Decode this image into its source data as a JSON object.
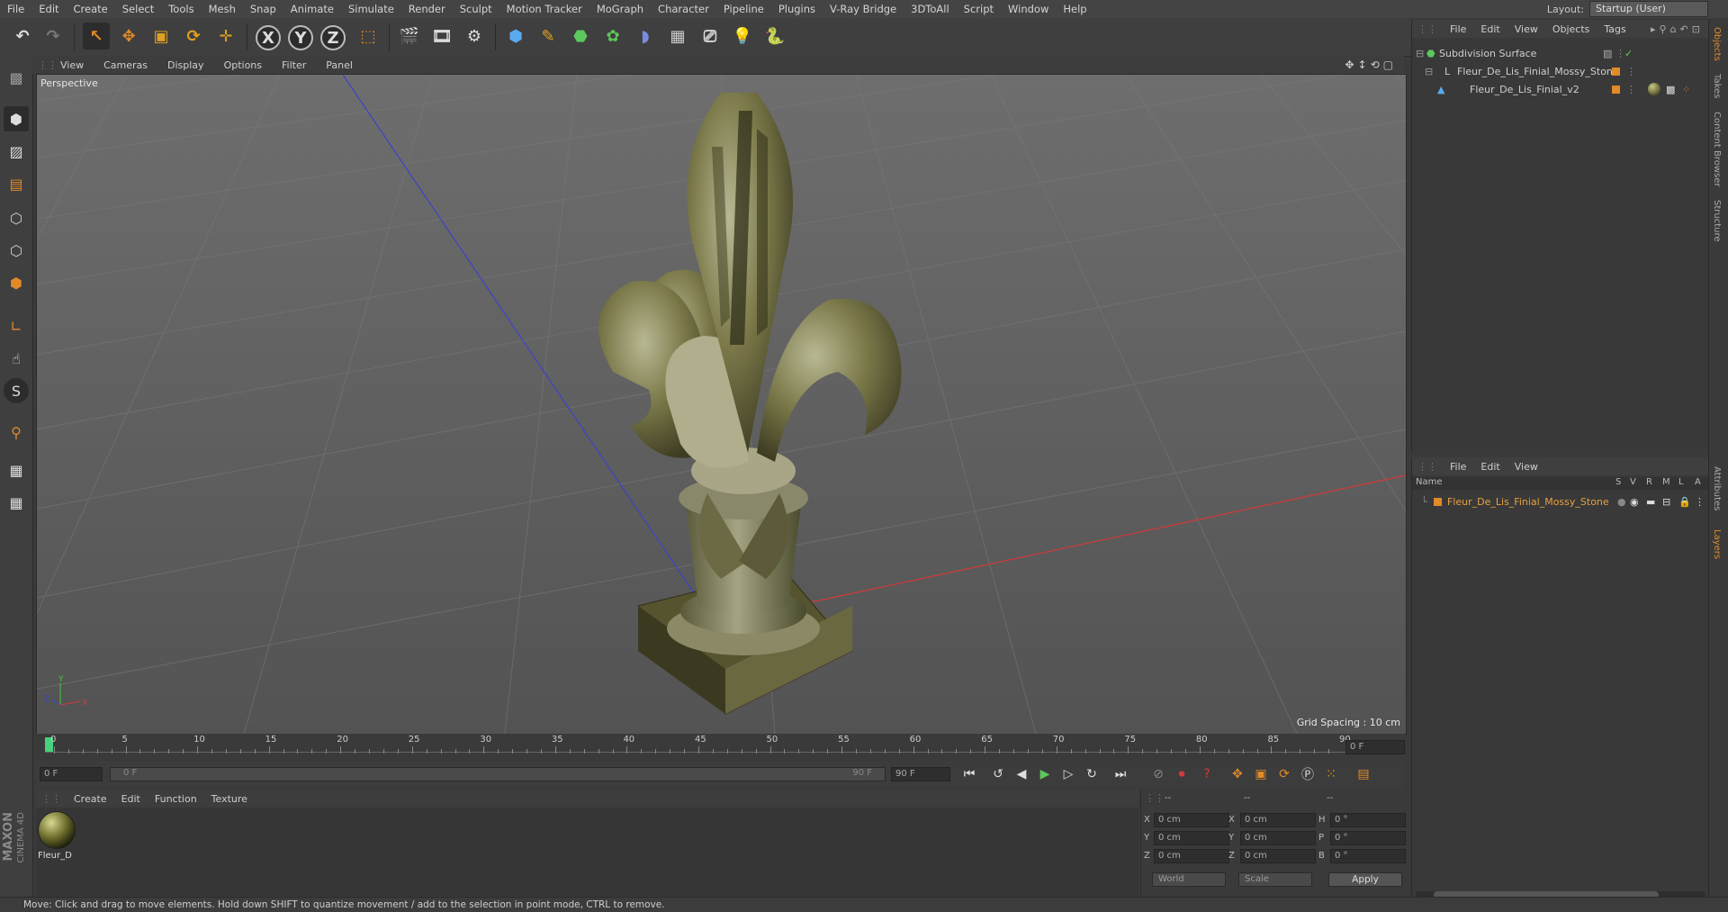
{
  "menubar": {
    "items": [
      "File",
      "Edit",
      "Create",
      "Select",
      "Tools",
      "Mesh",
      "Snap",
      "Animate",
      "Simulate",
      "Render",
      "Sculpt",
      "Motion Tracker",
      "MoGraph",
      "Character",
      "Pipeline",
      "Plugins",
      "V-Ray Bridge",
      "3DToAll",
      "Script",
      "Window",
      "Help"
    ],
    "layout_label": "Layout:",
    "layout_value": "Startup (User)"
  },
  "viewport": {
    "menu": [
      "View",
      "Cameras",
      "Display",
      "Options",
      "Filter",
      "Panel"
    ],
    "label": "Perspective",
    "grid_spacing": "Grid Spacing : 10 cm"
  },
  "timeline": {
    "ticks": [
      "0",
      "5",
      "10",
      "15",
      "20",
      "25",
      "30",
      "35",
      "40",
      "45",
      "50",
      "55",
      "60",
      "65",
      "70",
      "75",
      "80",
      "85",
      "90"
    ],
    "current_frame": "0 F",
    "start_frame": "0 F",
    "range_start": "0 F",
    "range_end": "90 F",
    "end_frame": "90 F",
    "frame_right": "0 F"
  },
  "material_manager": {
    "menu": [
      "Create",
      "Edit",
      "Function",
      "Texture"
    ],
    "material_name": "Fleur_D"
  },
  "coordinates": {
    "col_headers": [
      "--",
      "--",
      "--"
    ],
    "rows": [
      {
        "l1": "X",
        "v1": "0 cm",
        "l2": "X",
        "v2": "0 cm",
        "l3": "H",
        "v3": "0 °"
      },
      {
        "l1": "Y",
        "v1": "0 cm",
        "l2": "Y",
        "v2": "0 cm",
        "l3": "P",
        "v3": "0 °"
      },
      {
        "l1": "Z",
        "v1": "0 cm",
        "l2": "Z",
        "v2": "0 cm",
        "l3": "B",
        "v3": "0 °"
      }
    ],
    "world": "World",
    "scale": "Scale",
    "apply": "Apply"
  },
  "object_manager": {
    "menu": [
      "File",
      "Edit",
      "View",
      "Objects",
      "Tags"
    ],
    "objects": [
      "Subdivision Surface",
      "Fleur_De_Lis_Finial_Mossy_Stone",
      "Fleur_De_Lis_Finial_v2"
    ]
  },
  "layer_manager": {
    "menu": [
      "File",
      "Edit",
      "View"
    ],
    "columns": [
      "Name",
      "S",
      "V",
      "R",
      "M",
      "L",
      "A"
    ],
    "layer": "Fleur_De_Lis_Finial_Mossy_Stone"
  },
  "side_tabs": [
    "Objects",
    "Takes",
    "Content Browser",
    "Structure",
    "Attributes",
    "Layers"
  ],
  "brand": {
    "maxon": "MAXON",
    "cinema": "CINEMA 4D"
  },
  "status": "Move: Click and drag to move elements. Hold down SHIFT to quantize movement / add to the selection in point mode, CTRL to remove.",
  "colors": {
    "accent": "#e08a2a",
    "play": "#5cc85c",
    "timeline_marker": "#44d27a",
    "axis_x": "#d03a3a",
    "axis_z": "#3a44c8"
  }
}
